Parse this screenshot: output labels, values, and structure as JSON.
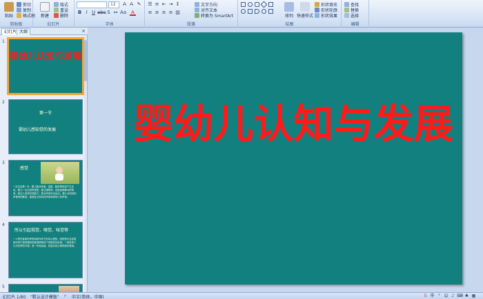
{
  "ribbon": {
    "clipboard": {
      "paste": "粘贴",
      "cut": "剪切",
      "copy": "复制",
      "format_painter": "格式刷",
      "group": "剪贴板"
    },
    "slides": {
      "new_slide": "新建",
      "layout": "版式",
      "reset": "重设",
      "delete": "删除",
      "group": "幻灯片"
    },
    "font": {
      "font_name": "",
      "font_size": "12",
      "group": "字体"
    },
    "paragraph": {
      "text_direction": "文字方向",
      "align_text": "对齐文本",
      "convert_smartart": "转换为 SmartArt",
      "group": "段落"
    },
    "drawing": {
      "arrange": "排列",
      "quick_styles": "快速样式",
      "shape_fill": "形状填充",
      "shape_outline": "形状轮廓",
      "shape_effects": "形状效果",
      "group": "绘图"
    },
    "editing": {
      "find": "查找",
      "replace": "替换",
      "select": "选择",
      "group": "编辑"
    }
  },
  "left_pane": {
    "tabs": [
      "幻灯片",
      "大纲"
    ],
    "slides": [
      {
        "num": "1",
        "title": "婴幼儿认知与发展"
      },
      {
        "num": "2",
        "heading": "第一节",
        "bullet": "婴幼儿感知觉的发展"
      },
      {
        "num": "3",
        "heading": "感觉",
        "paragraph": "• 出生后第一天，婴儿能对味道、温度、触觉等刺激产生反应。婴儿一出生就有视觉，能注视物体，还能追随移动的物体。新生儿具有听觉能力，能对声音作出反应。婴儿对妈妈的声音特别敏感，能够区分妈妈的声音和其他人的声音。"
      },
      {
        "num": "4",
        "heading": "所以引起视觉、嗅觉、味觉等",
        "paragraph": "• 人是在客观世界的刺激作用下形成心理的。感觉是对当前直接作用于感觉器官的客观事物的个别属性的反映。• 感觉是人认识世界的开端，是一切较高级、较复杂的心理现象的基础。"
      },
      {
        "num": "5"
      }
    ]
  },
  "slide": {
    "title": "婴幼儿认知与发展"
  },
  "status_bar": {
    "slide_count": "幻灯片 1/80",
    "theme": "\"默认设计模板\"",
    "language": "中文(简体，中国)"
  },
  "colors": {
    "slide_bg": "#138080",
    "title_red": "#ff1a1a",
    "ribbon_bg": "#dbe6f5"
  }
}
